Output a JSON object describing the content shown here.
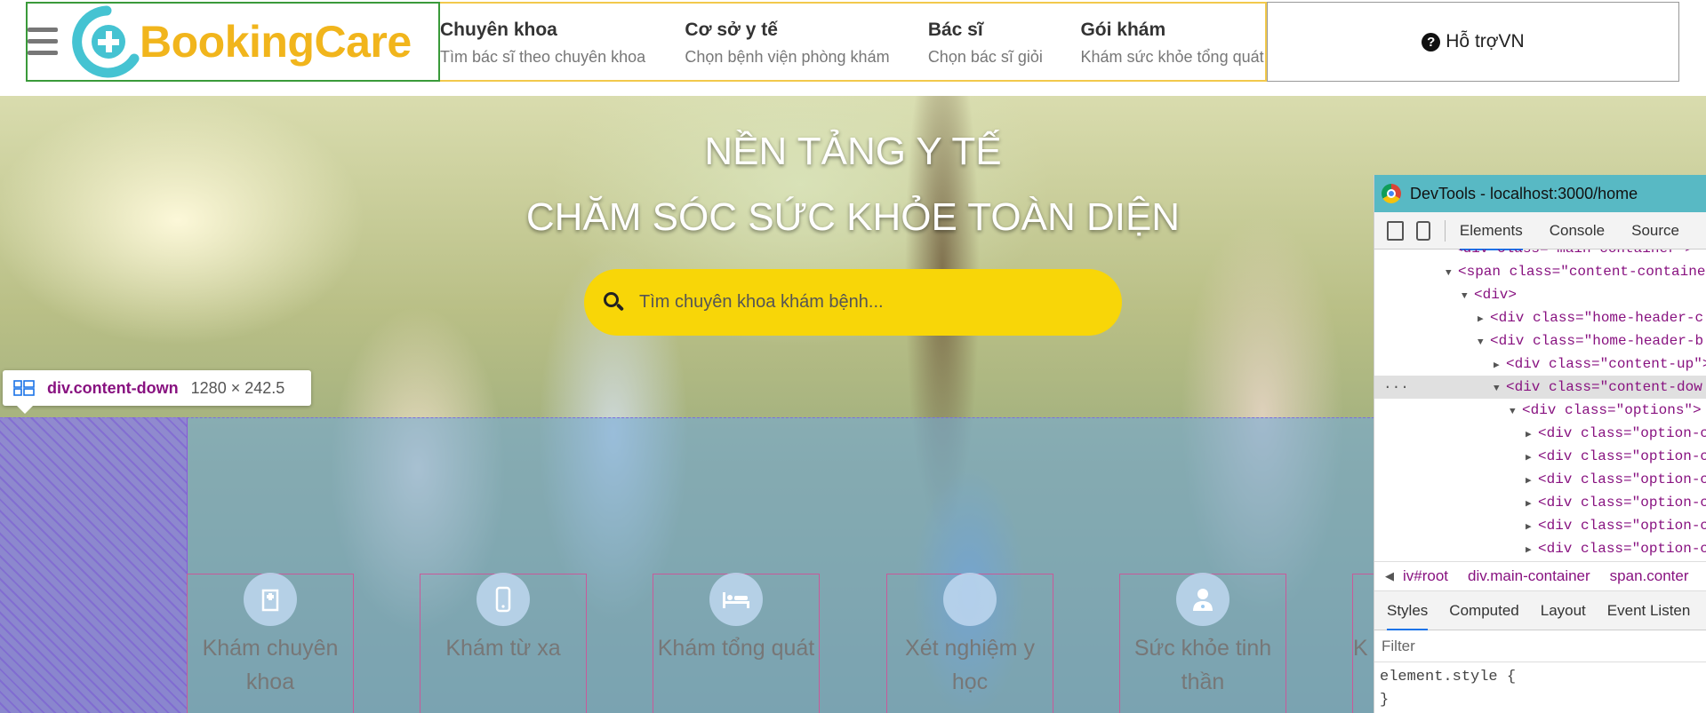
{
  "header": {
    "logo_text": "BookingCare",
    "nav": [
      {
        "title": "Chuyên khoa",
        "sub": "Tìm bác sĩ theo chuyên khoa"
      },
      {
        "title": "Cơ sở y tế",
        "sub": "Chọn bệnh viện phòng khám"
      },
      {
        "title": "Bác sĩ",
        "sub": "Chọn bác sĩ giỏi"
      },
      {
        "title": "Gói khám",
        "sub": "Khám sức khỏe tổng quát"
      }
    ],
    "support": "Hỗ trợVN",
    "support_icon": "?"
  },
  "banner": {
    "title1": "NỀN TẢNG Y TẾ",
    "title2": "CHĂM SÓC SỨC KHỎE TOÀN DIỆN",
    "search_placeholder": "Tìm chuyên khoa khám bệnh..."
  },
  "inspector_tag": {
    "element": "div.content-down",
    "size": "1280 × 242.5"
  },
  "options": [
    {
      "label": "Khám chuyên khoa",
      "icon": "hospital-icon"
    },
    {
      "label": "Khám từ xa",
      "icon": "mobile-icon"
    },
    {
      "label": "Khám tổng quát",
      "icon": "bed-icon"
    },
    {
      "label": "Xét nghiệm y học",
      "icon": "flask-icon"
    },
    {
      "label": "Sức khỏe tinh thần",
      "icon": "user-doctor-icon"
    },
    {
      "label": "K",
      "icon": "tooth-icon"
    }
  ],
  "devtools": {
    "title": "DevTools - localhost:3000/home",
    "tabs": [
      "Elements",
      "Console",
      "Source"
    ],
    "lines": [
      {
        "tag": "<div class=\"main-container\">",
        "arrow": ""
      },
      {
        "tag": "<span class=\"content-containe",
        "arrow": "▼"
      },
      {
        "tag": "<div>",
        "arrow": "▼"
      },
      {
        "tag": "<div class=\"home-header-c",
        "arrow": "▶"
      },
      {
        "tag": "<div class=\"home-header-b",
        "arrow": "▼"
      },
      {
        "tag": "<div class=\"content-up\">",
        "arrow": "▶"
      },
      {
        "tag": "<div class=\"content-dow",
        "arrow": "▼"
      },
      {
        "tag": "<div class=\"options\">",
        "arrow": "▼"
      },
      {
        "tag": "<div class=\"option-c",
        "arrow": "▶"
      },
      {
        "tag": "<div class=\"option-c",
        "arrow": "▶"
      },
      {
        "tag": "<div class=\"option-c",
        "arrow": "▶"
      },
      {
        "tag": "<div class=\"option-c",
        "arrow": "▶"
      },
      {
        "tag": "<div class=\"option-c",
        "arrow": "▶"
      },
      {
        "tag": "<div class=\"option-c",
        "arrow": "▶"
      }
    ],
    "crumbs": [
      "iv#root",
      "div.main-container",
      "span.conter"
    ],
    "subtabs": [
      "Styles",
      "Computed",
      "Layout",
      "Event Listen"
    ],
    "filter_placeholder": "Filter",
    "style_line1": "element.style {",
    "style_line2": "}"
  }
}
